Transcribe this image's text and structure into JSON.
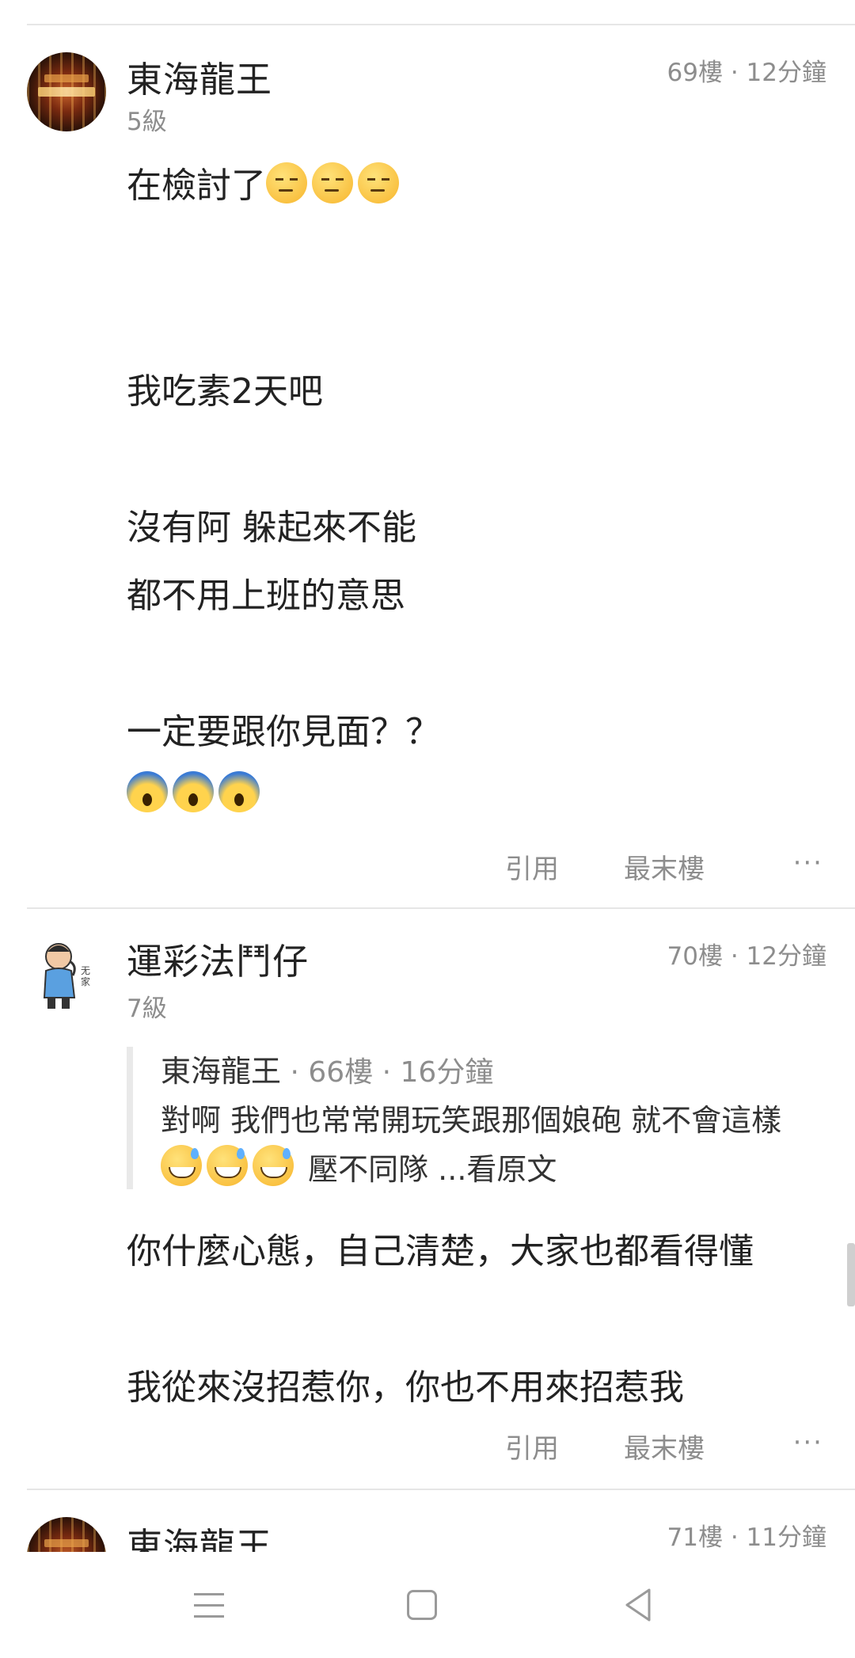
{
  "posts": [
    {
      "username": "東海龍王",
      "level": "5級",
      "floor": "69樓",
      "time": "12分鐘",
      "lines": [
        "在檢討了",
        "我吃素2天吧",
        "沒有阿 躲起來不能",
        "都不用上班的意思",
        "一定要跟你見面？？"
      ],
      "emojis_1": "sad-face",
      "emojis_2": "scream-face"
    },
    {
      "username": "運彩法鬥仔",
      "level": "7級",
      "floor": "70樓",
      "time": "12分鐘",
      "quote": {
        "name": "東海龍王",
        "floor": "66樓",
        "time": "16分鐘",
        "line1": "對啊 我們也常常開玩笑跟那個娘砲 就不會這樣",
        "line2": "壓不同隊 ...看原文"
      },
      "lines": [
        "你什麼心態，自己清楚，大家也都看得懂",
        "我從來沒招惹你，你也不用來招惹我"
      ]
    },
    {
      "username": "東海龍王",
      "floor": "71樓",
      "time": "11分鐘"
    }
  ],
  "actions": {
    "quote_label": "引用",
    "last_floor_label": "最末樓",
    "more_label": "···"
  },
  "separator": " · ",
  "colors": {
    "text": "#222222",
    "muted": "#8d8d8d",
    "divider": "#e6e6e6"
  },
  "navbar": {
    "menu_icon": "menu-icon",
    "home_icon": "home-square-icon",
    "back_icon": "back-triangle-icon"
  }
}
